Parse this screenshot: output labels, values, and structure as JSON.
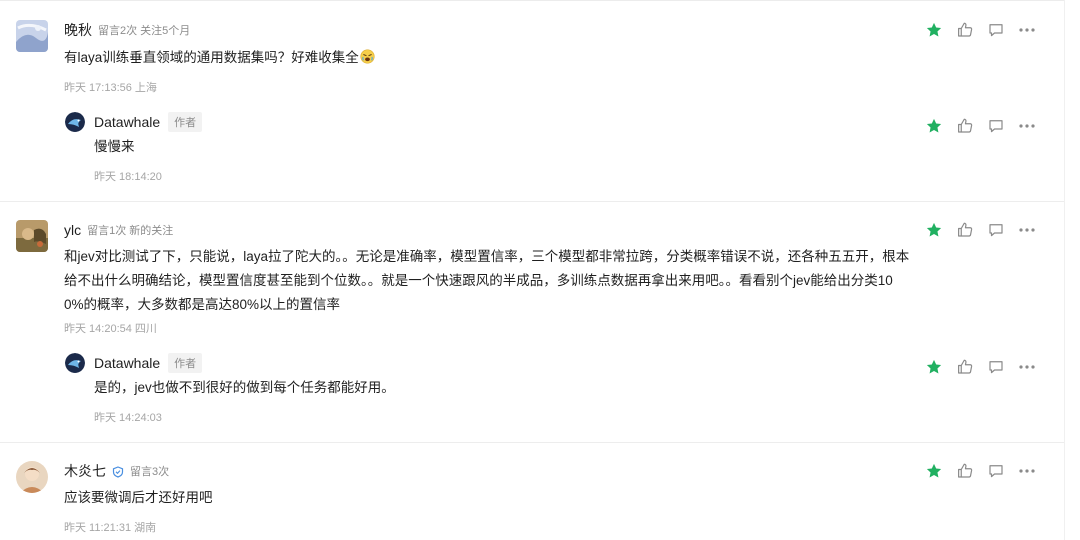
{
  "colors": {
    "star": "#21b061",
    "icon": "#8a8a8a",
    "meta": "#8c8c8c"
  },
  "comments": [
    {
      "user": "晚秋",
      "meta": "留言2次 关注5个月",
      "text": "有laya训练垂直领域的通用数据集吗？好难收集全",
      "emoji": "weary-face-emoji",
      "time": "昨天 17:13:56 上海",
      "reply": {
        "user": "Datawhale",
        "tag": "作者",
        "text": "慢慢来",
        "time": "昨天 18:14:20"
      }
    },
    {
      "user": "ylc",
      "meta": "留言1次 新的关注",
      "text_lines": [
        "和jev对比测试了下，只能说，laya拉了陀大的。。无论是准确率，模型置信率，三个模型都非常拉跨，分类概率错误不说，还各种五五开，根本",
        "给不出什么明确结论，模型置信度甚至能到个位数。。就是一个快速跟风的半成品，多训练点数据再拿出来用吧。。看看别个jev能给出分类10",
        "0%的概率，大多数都是高达80%以上的置信率"
      ],
      "time": "昨天 14:20:54 四川",
      "reply": {
        "user": "Datawhale",
        "tag": "作者",
        "text": "是的，jev也做不到很好的做到每个任务都能好用。",
        "time": "昨天 14:24:03"
      }
    },
    {
      "user": "木炎七",
      "badge_icon": "shield-badge-icon",
      "meta": "留言3次",
      "text": "应该要微调后才还好用吧",
      "time": "昨天 11:21:31 湖南"
    }
  ]
}
